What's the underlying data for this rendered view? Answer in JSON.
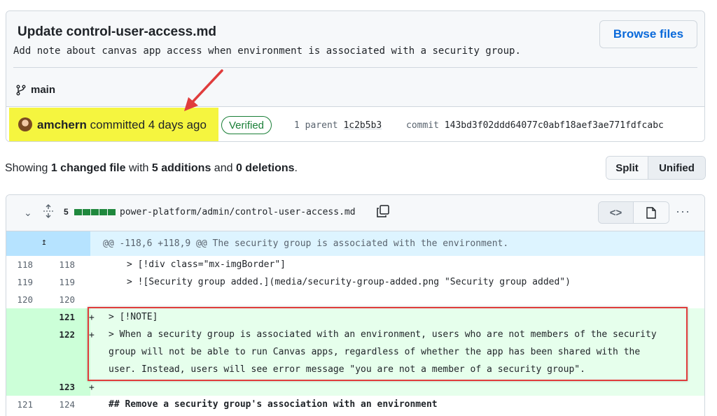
{
  "commit": {
    "title": "Update control-user-access.md",
    "description": "Add note about canvas app access when environment is associated with a security group.",
    "browse_label": "Browse files",
    "branch": "main",
    "author": "amchern",
    "committed_text": "committed 4 days ago",
    "verified_label": "Verified",
    "parent_label": "1 parent",
    "parent_sha": "1c2b5b3",
    "commit_label": "commit",
    "commit_sha": "143bd3f02ddd64077c0abf18aef3ae771fdfcabc"
  },
  "summary": {
    "showing": "Showing",
    "changed": "1 changed file",
    "with": "with",
    "additions": "5 additions",
    "and": "and",
    "deletions": "0 deletions",
    "end": "."
  },
  "view_toggle": {
    "split": "Split",
    "unified": "Unified",
    "selected": "Unified"
  },
  "file": {
    "change_count": "5",
    "path": "power-platform/admin/control-user-access.md",
    "hunk_header": "@@ -118,6 +118,9 @@ The security group is associated with the environment.",
    "lines": [
      {
        "old": "118",
        "new": "118",
        "type": "context",
        "text": "> [!div class=\"mx-imgBorder\"]"
      },
      {
        "old": "119",
        "new": "119",
        "type": "context",
        "text": "> ![Security group added.](media/security-group-added.png \"Security group added\")"
      },
      {
        "old": "120",
        "new": "120",
        "type": "context",
        "text": ""
      },
      {
        "old": "",
        "new": "121",
        "type": "add",
        "text": "> [!NOTE]"
      },
      {
        "old": "",
        "new": "122",
        "type": "add",
        "text": "> When a security group is associated with an environment, users who are not members of the security"
      },
      {
        "old": "",
        "new": "",
        "type": "add-cont",
        "text": "group will not be able to run Canvas apps, regardless of whether the app has been shared with the"
      },
      {
        "old": "",
        "new": "",
        "type": "add-cont",
        "text": "user. Instead, users will see error message \"you are not a member of a security group\"."
      },
      {
        "old": "",
        "new": "123",
        "type": "add",
        "text": ""
      },
      {
        "old": "121",
        "new": "124",
        "type": "context",
        "text": "## Remove a security group's association with an environment"
      }
    ]
  },
  "colors": {
    "highlight": "#f5f53f",
    "annotation_red": "#e03c3c",
    "link_blue": "#0969da",
    "verified_green": "#1a7f37",
    "addition_green": "#1f883d"
  }
}
